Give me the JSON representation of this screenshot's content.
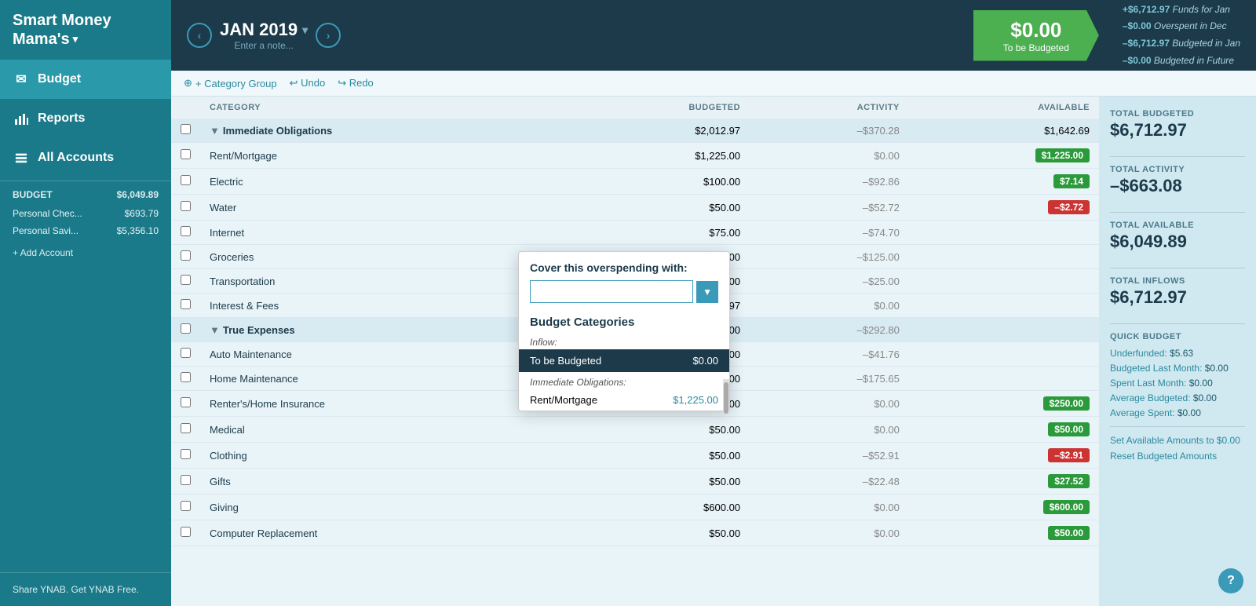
{
  "app": {
    "title": "Smart Money Mama's",
    "title_line1": "Smart Money",
    "title_line2": "Mama's",
    "dropdown_arrow": "▾"
  },
  "sidebar": {
    "nav_items": [
      {
        "id": "budget",
        "label": "Budget",
        "icon": "✉",
        "active": true
      },
      {
        "id": "reports",
        "label": "Reports",
        "icon": "📊",
        "active": false
      },
      {
        "id": "all-accounts",
        "label": "All Accounts",
        "icon": "🏦",
        "active": false
      }
    ],
    "budget_section": {
      "label": "BUDGET",
      "amount": "$6,049.89"
    },
    "accounts": [
      {
        "name": "Personal Chec...",
        "balance": "$693.79"
      },
      {
        "name": "Personal Savi...",
        "balance": "$5,356.10"
      }
    ],
    "add_account_label": "+ Add Account",
    "share_promo": "Share YNAB. Get YNAB Free."
  },
  "topbar": {
    "prev_arrow": "‹",
    "next_arrow": "›",
    "month": "JAN 2019",
    "month_dropdown": "▾",
    "note_placeholder": "Enter a note...",
    "to_budget": {
      "amount": "$0.00",
      "label": "To be Budgeted"
    },
    "summary": [
      {
        "text": "+$6,712.97",
        "label": "Funds for Jan"
      },
      {
        "text": "–$0.00",
        "label": "Overspent in Dec"
      },
      {
        "text": "–$6,712.97",
        "label": "Budgeted in Jan"
      },
      {
        "text": "–$0.00",
        "label": "Budgeted in Future"
      }
    ]
  },
  "toolbar": {
    "category_group_label": "+ Category Group",
    "undo_label": "↩ Undo",
    "redo_label": "↪ Redo"
  },
  "table": {
    "headers": [
      {
        "id": "checkbox",
        "label": ""
      },
      {
        "id": "category",
        "label": "CATEGORY"
      },
      {
        "id": "budgeted",
        "label": "BUDGETED"
      },
      {
        "id": "activity",
        "label": "ACTIVITY"
      },
      {
        "id": "available",
        "label": "AVAILABLE"
      }
    ],
    "groups": [
      {
        "name": "Immediate Obligations",
        "budgeted": "$2,012.97",
        "activity": "–$370.28",
        "available": "$1,642.69",
        "categories": [
          {
            "name": "Rent/Mortgage",
            "budgeted": "$1,225.00",
            "activity": "$0.00",
            "available": "$1,225.00",
            "avail_type": "green"
          },
          {
            "name": "Electric",
            "budgeted": "$100.00",
            "activity": "–$92.86",
            "available": "$7.14",
            "avail_type": "green"
          },
          {
            "name": "Water",
            "budgeted": "$50.00",
            "activity": "–$52.72",
            "available": "–$2.72",
            "avail_type": "red"
          },
          {
            "name": "Internet",
            "budgeted": "$75.00",
            "activity": "–$74.70",
            "available": "",
            "avail_type": "none"
          },
          {
            "name": "Groceries",
            "budgeted": "$300.00",
            "activity": "–$125.00",
            "available": "",
            "avail_type": "none"
          },
          {
            "name": "Transportation",
            "budgeted": "$250.00",
            "activity": "–$25.00",
            "available": "",
            "avail_type": "none"
          },
          {
            "name": "Interest & Fees",
            "budgeted": "$12.97",
            "activity": "$0.00",
            "available": "",
            "avail_type": "none"
          }
        ]
      },
      {
        "name": "True Expenses",
        "budgeted": "$1,750.00",
        "activity": "–$292.80",
        "available": "",
        "categories": [
          {
            "name": "Auto Maintenance",
            "budgeted": "$100.00",
            "activity": "–$41.76",
            "available": "",
            "avail_type": "none"
          },
          {
            "name": "Home Maintenance",
            "budgeted": "$250.00",
            "activity": "–$175.65",
            "available": "",
            "avail_type": "none"
          },
          {
            "name": "Renter's/Home Insurance",
            "budgeted": "$250.00",
            "activity": "$0.00",
            "available": "$250.00",
            "avail_type": "green"
          },
          {
            "name": "Medical",
            "budgeted": "$50.00",
            "activity": "$0.00",
            "available": "$50.00",
            "avail_type": "green"
          },
          {
            "name": "Clothing",
            "budgeted": "$50.00",
            "activity": "–$52.91",
            "available": "–$2.91",
            "avail_type": "red"
          },
          {
            "name": "Gifts",
            "budgeted": "$50.00",
            "activity": "–$22.48",
            "available": "$27.52",
            "avail_type": "green"
          },
          {
            "name": "Giving",
            "budgeted": "$600.00",
            "activity": "$0.00",
            "available": "$600.00",
            "avail_type": "green"
          },
          {
            "name": "Computer Replacement",
            "budgeted": "$50.00",
            "activity": "$0.00",
            "available": "$50.00",
            "avail_type": "green"
          }
        ]
      }
    ]
  },
  "right_panel": {
    "total_budgeted_label": "TOTAL BUDGETED",
    "total_budgeted_value": "$6,712.97",
    "total_activity_label": "TOTAL ACTIVITY",
    "total_activity_value": "–$663.08",
    "total_available_label": "TOTAL AVAILABLE",
    "total_available_value": "$6,049.89",
    "total_inflows_label": "TOTAL INFLOWS",
    "total_inflows_value": "$6,712.97",
    "quick_budget_label": "QUICK BUDGET",
    "quick_budget_items": [
      {
        "label": "Underfunded:",
        "value": "$5.63"
      },
      {
        "label": "Budgeted Last Month:",
        "value": "$0.00"
      },
      {
        "label": "Spent Last Month:",
        "value": "$0.00"
      },
      {
        "label": "Average Budgeted:",
        "value": "$0.00"
      },
      {
        "label": "Average Spent:",
        "value": "$0.00"
      }
    ],
    "actions": [
      "Set Available Amounts to $0.00",
      "Reset Budgeted Amounts"
    ]
  },
  "cover_dialog": {
    "title": "Cover this overspending with:",
    "input_placeholder": "",
    "categories_label": "Budget Categories",
    "inflow_label": "Inflow:",
    "inflow_item": "To be Budgeted",
    "inflow_amount": "$0.00",
    "immediate_label": "Immediate Obligations:",
    "rent_option": "Rent/Mortgage",
    "rent_amount": "$1,225.00"
  },
  "help_btn": "?"
}
